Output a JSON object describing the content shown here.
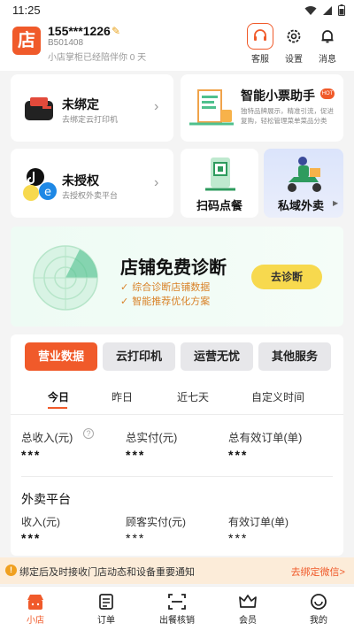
{
  "status": {
    "time": "11:25"
  },
  "store": {
    "logo_char": "店",
    "name": "155***1226",
    "id": "B501408",
    "days_text": "小店掌柜已经陪伴你 0 天"
  },
  "header_buttons": [
    {
      "label": "客服"
    },
    {
      "label": "设置"
    },
    {
      "label": "消息"
    }
  ],
  "cards": {
    "printer": {
      "title": "未绑定",
      "sub": "去绑定云打印机"
    },
    "receipt": {
      "title": "智能小票助手",
      "badge": "HOT",
      "sub": "独特品牌展示，精准引流，促进复购，轻松管理菜单菜品分类"
    },
    "platform": {
      "title": "未授权",
      "sub": "去授权外卖平台"
    },
    "scan": {
      "title": "扫码点餐"
    },
    "private": {
      "title": "私域外卖"
    }
  },
  "diagnosis": {
    "title": "店铺免费诊断",
    "line1": "综合诊断店铺数据",
    "line2": "智能推荐优化方案",
    "button": "去诊断"
  },
  "tabs": [
    {
      "label": "营业数据"
    },
    {
      "label": "云打印机"
    },
    {
      "label": "运营无忧"
    },
    {
      "label": "其他服务"
    }
  ],
  "subtabs": [
    {
      "label": "今日"
    },
    {
      "label": "昨日"
    },
    {
      "label": "近七天"
    },
    {
      "label": "自定义时间"
    }
  ],
  "metrics": [
    {
      "label": "总收入(元)",
      "value": "***"
    },
    {
      "label": "总实付(元)",
      "value": "***"
    },
    {
      "label": "总有效订单(单)",
      "value": "***"
    }
  ],
  "platform_section": {
    "title": "外卖平台",
    "metrics": [
      {
        "label": "收入(元)",
        "value": "***"
      },
      {
        "label": "顾客实付(元)",
        "value": "***"
      },
      {
        "label": "有效订单(单)",
        "value": "***"
      }
    ]
  },
  "notice": {
    "text": "绑定后及时接收门店动态和设备重要通知",
    "link": "去绑定微信>"
  },
  "nav": [
    {
      "label": "小店"
    },
    {
      "label": "订单"
    },
    {
      "label": "出餐核销"
    },
    {
      "label": "会员"
    },
    {
      "label": "我的"
    }
  ],
  "colors": {
    "accent": "#f05a2a",
    "button_yellow": "#f7d94e",
    "notice_bg": "#fcecd9"
  }
}
